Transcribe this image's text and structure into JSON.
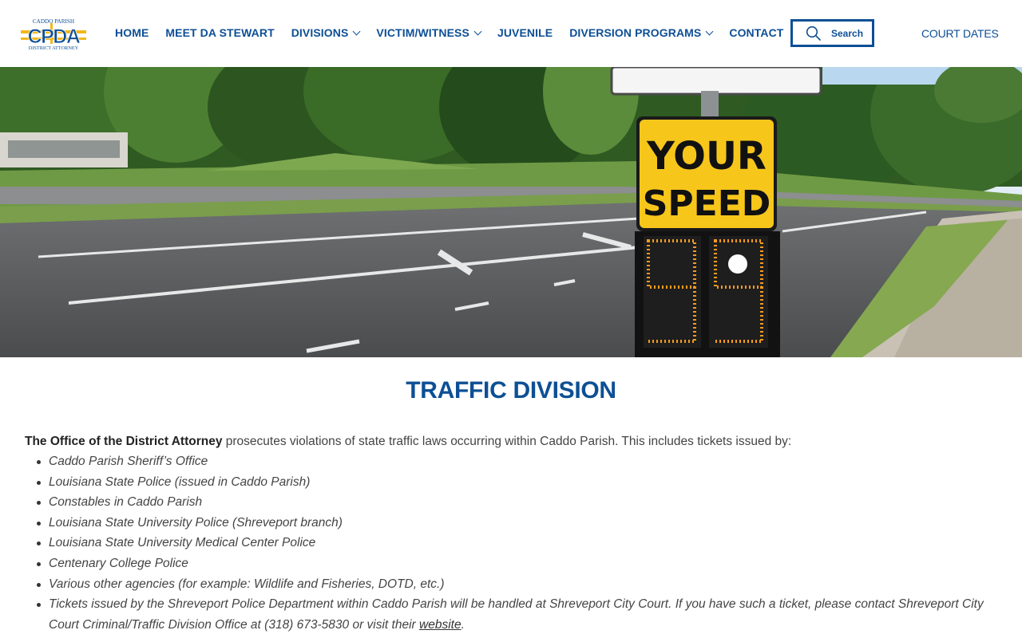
{
  "header": {
    "logo": {
      "top_text": "CADDO PARISH",
      "letters": "CPDA",
      "bottom_text": "DISTRICT ATTORNEY"
    },
    "nav": [
      {
        "label": "HOME",
        "has_dropdown": false
      },
      {
        "label": "MEET DA STEWART",
        "has_dropdown": false
      },
      {
        "label": "DIVISIONS",
        "has_dropdown": true
      },
      {
        "label": "VICTIM/WITNESS",
        "has_dropdown": true
      },
      {
        "label": "JUVENILE",
        "has_dropdown": false
      },
      {
        "label": "DIVERSION PROGRAMS",
        "has_dropdown": true
      },
      {
        "label": "CONTACT",
        "has_dropdown": false
      }
    ],
    "search_label": "Search",
    "court_dates_label": "COURT DATES"
  },
  "hero": {
    "sign_line1": "YOUR",
    "sign_line2": "SPEED"
  },
  "main": {
    "title": "TRAFFIC DIVISION",
    "intro_bold": "The Office of the District Attorney",
    "intro_rest": " prosecutes violations of state traffic laws occurring within Caddo Parish. This includes tickets issued by:",
    "agencies": [
      "Caddo Parish Sheriff’s Office",
      "Louisiana State Police (issued in Caddo Parish)",
      "Constables in Caddo Parish",
      "Louisiana State University Police (Shreveport branch)",
      "Louisiana State University Medical Center Police",
      "Centenary College Police",
      "Various other agencies (for example: Wildlife and Fisheries, DOTD, etc.)"
    ],
    "city_note_before": "Tickets issued by the Shreveport Police Department within Caddo Parish will be handled at Shreveport City Court. If you have such a ticket, please contact Shreveport City Court Criminal/Traffic Division Office at (318) 673-5830 or visit their ",
    "city_note_link": "website",
    "city_note_after": "."
  },
  "colors": {
    "brand_blue": "#0d4f95",
    "sign_yellow": "#f7c61b",
    "led_orange": "#f39a1e"
  },
  "icons": {
    "search": "search-icon",
    "dropdown": "chevron-down-icon"
  }
}
